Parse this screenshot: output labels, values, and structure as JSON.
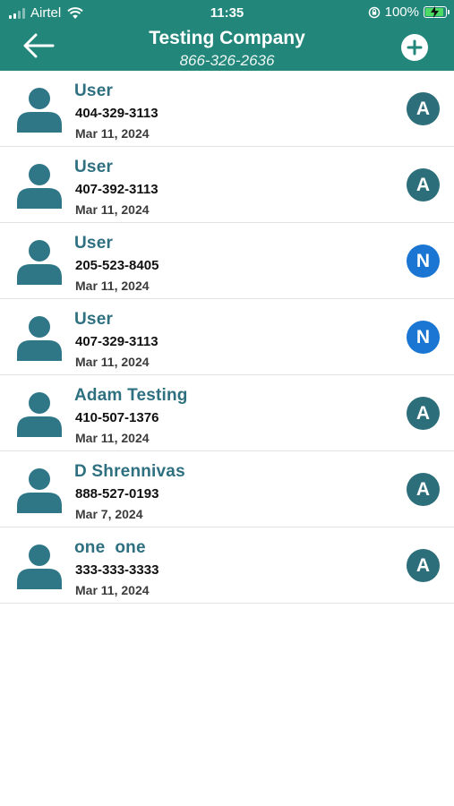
{
  "status_bar": {
    "carrier": "Airtel",
    "time": "11:35",
    "battery": "100%"
  },
  "header": {
    "title": "Testing Company",
    "subtitle": "866-326-2636"
  },
  "colors": {
    "header_bg": "#22877a",
    "name_text": "#2e7080",
    "badge_A": "#2d6e7b",
    "badge_N": "#1a76d2"
  },
  "contacts": [
    {
      "name": "User",
      "phone": "404-329-3113",
      "date": "Mar 11, 2024",
      "badge": "A"
    },
    {
      "name": "User",
      "phone": "407-392-3113",
      "date": "Mar 11, 2024",
      "badge": "A"
    },
    {
      "name": "User",
      "phone": "205-523-8405",
      "date": "Mar 11, 2024",
      "badge": "N"
    },
    {
      "name": "User",
      "phone": "407-329-3113",
      "date": "Mar 11, 2024",
      "badge": "N"
    },
    {
      "name": "Adam Testing",
      "phone": "410-507-1376",
      "date": "Mar 11, 2024",
      "badge": "A"
    },
    {
      "name": "D Shrennivas",
      "phone": "888-527-0193",
      "date": "Mar 7, 2024",
      "badge": "A"
    },
    {
      "name": "one  one",
      "phone": "333-333-3333",
      "date": "Mar 11, 2024",
      "badge": "A"
    }
  ]
}
